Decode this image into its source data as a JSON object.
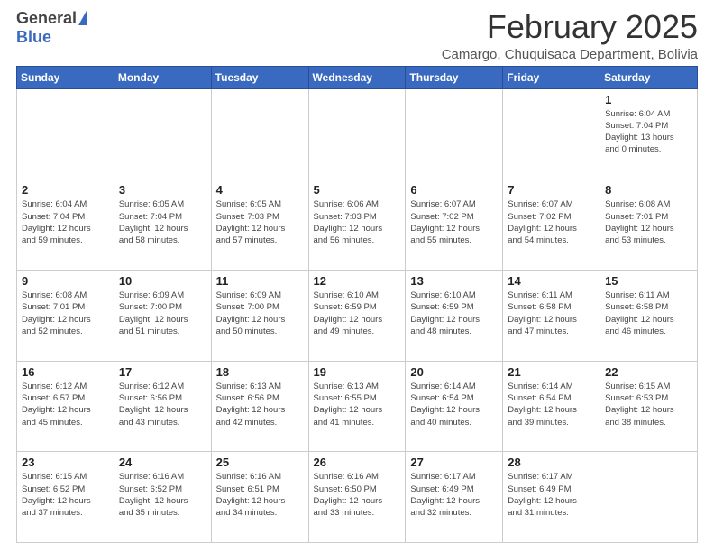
{
  "logo": {
    "general": "General",
    "blue": "Blue"
  },
  "header": {
    "month": "February 2025",
    "location": "Camargo, Chuquisaca Department, Bolivia"
  },
  "weekdays": [
    "Sunday",
    "Monday",
    "Tuesday",
    "Wednesday",
    "Thursday",
    "Friday",
    "Saturday"
  ],
  "weeks": [
    [
      {
        "day": "",
        "info": ""
      },
      {
        "day": "",
        "info": ""
      },
      {
        "day": "",
        "info": ""
      },
      {
        "day": "",
        "info": ""
      },
      {
        "day": "",
        "info": ""
      },
      {
        "day": "",
        "info": ""
      },
      {
        "day": "1",
        "info": "Sunrise: 6:04 AM\nSunset: 7:04 PM\nDaylight: 13 hours\nand 0 minutes."
      }
    ],
    [
      {
        "day": "2",
        "info": "Sunrise: 6:04 AM\nSunset: 7:04 PM\nDaylight: 12 hours\nand 59 minutes."
      },
      {
        "day": "3",
        "info": "Sunrise: 6:05 AM\nSunset: 7:04 PM\nDaylight: 12 hours\nand 58 minutes."
      },
      {
        "day": "4",
        "info": "Sunrise: 6:05 AM\nSunset: 7:03 PM\nDaylight: 12 hours\nand 57 minutes."
      },
      {
        "day": "5",
        "info": "Sunrise: 6:06 AM\nSunset: 7:03 PM\nDaylight: 12 hours\nand 56 minutes."
      },
      {
        "day": "6",
        "info": "Sunrise: 6:07 AM\nSunset: 7:02 PM\nDaylight: 12 hours\nand 55 minutes."
      },
      {
        "day": "7",
        "info": "Sunrise: 6:07 AM\nSunset: 7:02 PM\nDaylight: 12 hours\nand 54 minutes."
      },
      {
        "day": "8",
        "info": "Sunrise: 6:08 AM\nSunset: 7:01 PM\nDaylight: 12 hours\nand 53 minutes."
      }
    ],
    [
      {
        "day": "9",
        "info": "Sunrise: 6:08 AM\nSunset: 7:01 PM\nDaylight: 12 hours\nand 52 minutes."
      },
      {
        "day": "10",
        "info": "Sunrise: 6:09 AM\nSunset: 7:00 PM\nDaylight: 12 hours\nand 51 minutes."
      },
      {
        "day": "11",
        "info": "Sunrise: 6:09 AM\nSunset: 7:00 PM\nDaylight: 12 hours\nand 50 minutes."
      },
      {
        "day": "12",
        "info": "Sunrise: 6:10 AM\nSunset: 6:59 PM\nDaylight: 12 hours\nand 49 minutes."
      },
      {
        "day": "13",
        "info": "Sunrise: 6:10 AM\nSunset: 6:59 PM\nDaylight: 12 hours\nand 48 minutes."
      },
      {
        "day": "14",
        "info": "Sunrise: 6:11 AM\nSunset: 6:58 PM\nDaylight: 12 hours\nand 47 minutes."
      },
      {
        "day": "15",
        "info": "Sunrise: 6:11 AM\nSunset: 6:58 PM\nDaylight: 12 hours\nand 46 minutes."
      }
    ],
    [
      {
        "day": "16",
        "info": "Sunrise: 6:12 AM\nSunset: 6:57 PM\nDaylight: 12 hours\nand 45 minutes."
      },
      {
        "day": "17",
        "info": "Sunrise: 6:12 AM\nSunset: 6:56 PM\nDaylight: 12 hours\nand 43 minutes."
      },
      {
        "day": "18",
        "info": "Sunrise: 6:13 AM\nSunset: 6:56 PM\nDaylight: 12 hours\nand 42 minutes."
      },
      {
        "day": "19",
        "info": "Sunrise: 6:13 AM\nSunset: 6:55 PM\nDaylight: 12 hours\nand 41 minutes."
      },
      {
        "day": "20",
        "info": "Sunrise: 6:14 AM\nSunset: 6:54 PM\nDaylight: 12 hours\nand 40 minutes."
      },
      {
        "day": "21",
        "info": "Sunrise: 6:14 AM\nSunset: 6:54 PM\nDaylight: 12 hours\nand 39 minutes."
      },
      {
        "day": "22",
        "info": "Sunrise: 6:15 AM\nSunset: 6:53 PM\nDaylight: 12 hours\nand 38 minutes."
      }
    ],
    [
      {
        "day": "23",
        "info": "Sunrise: 6:15 AM\nSunset: 6:52 PM\nDaylight: 12 hours\nand 37 minutes."
      },
      {
        "day": "24",
        "info": "Sunrise: 6:16 AM\nSunset: 6:52 PM\nDaylight: 12 hours\nand 35 minutes."
      },
      {
        "day": "25",
        "info": "Sunrise: 6:16 AM\nSunset: 6:51 PM\nDaylight: 12 hours\nand 34 minutes."
      },
      {
        "day": "26",
        "info": "Sunrise: 6:16 AM\nSunset: 6:50 PM\nDaylight: 12 hours\nand 33 minutes."
      },
      {
        "day": "27",
        "info": "Sunrise: 6:17 AM\nSunset: 6:49 PM\nDaylight: 12 hours\nand 32 minutes."
      },
      {
        "day": "28",
        "info": "Sunrise: 6:17 AM\nSunset: 6:49 PM\nDaylight: 12 hours\nand 31 minutes."
      },
      {
        "day": "",
        "info": ""
      }
    ]
  ]
}
